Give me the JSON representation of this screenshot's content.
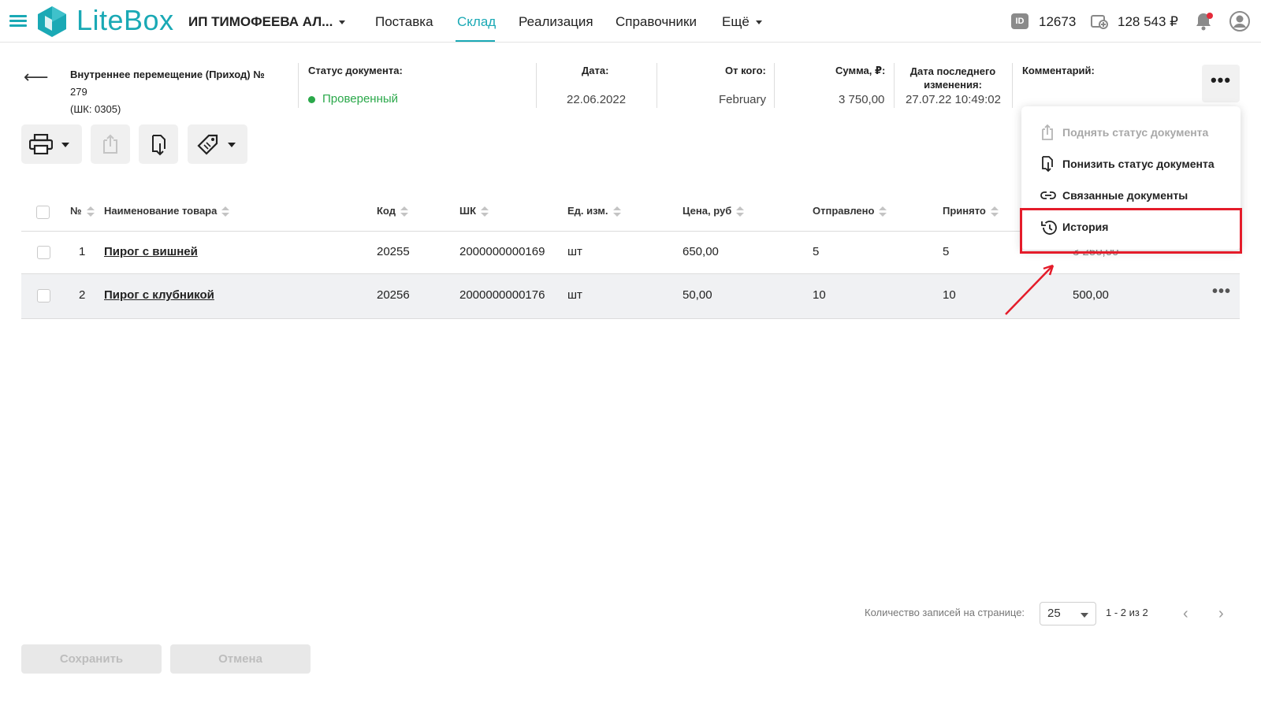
{
  "header": {
    "logo_text": "LiteBox",
    "org_name": "ИП ТИМОФЕЕВА АЛ...",
    "nav": [
      {
        "label": "Поставка"
      },
      {
        "label": "Склад"
      },
      {
        "label": "Реализация"
      },
      {
        "label": "Справочники"
      },
      {
        "label": "Ещё"
      }
    ],
    "id_badge": "ID",
    "id_value": "12673",
    "balance": "128 543 ₽"
  },
  "document": {
    "title": "Внутреннее перемещение (Приход) №",
    "number": "279",
    "barcode": "(ШК: 0305)",
    "status_label": "Статус документа:",
    "status_value": "Проверенный",
    "date_label": "Дата:",
    "date_value": "22.06.2022",
    "from_label": "От кого:",
    "from_value": "February",
    "sum_label": "Сумма, ₽:",
    "sum_value": "3 750,00",
    "modified_label": "Дата последнего изменения:",
    "modified_value": "27.07.22 10:49:02",
    "comment_label": "Комментарий:"
  },
  "table": {
    "columns": [
      "№",
      "Наименование товара",
      "Код",
      "ШК",
      "Ед. изм.",
      "Цена, руб",
      "Отправлено",
      "Принято"
    ],
    "rows": [
      {
        "n": "1",
        "name": "Пирог с вишней",
        "code": "20255",
        "barcode": "2000000000169",
        "unit": "шт",
        "price": "650,00",
        "sent": "5",
        "received": "5",
        "sum": "3 250,00"
      },
      {
        "n": "2",
        "name": "Пирог с клубникой",
        "code": "20256",
        "barcode": "2000000000176",
        "unit": "шт",
        "price": "50,00",
        "sent": "10",
        "received": "10",
        "sum": "500,00"
      }
    ]
  },
  "menu": {
    "items": [
      {
        "label": "Поднять статус документа",
        "icon": "raise-status-icon",
        "disabled": true
      },
      {
        "label": "Понизить статус документа",
        "icon": "lower-status-icon",
        "disabled": false
      },
      {
        "label": "Связанные документы",
        "icon": "link-icon",
        "disabled": false
      },
      {
        "label": "История",
        "icon": "history-icon",
        "disabled": false
      }
    ]
  },
  "pagination": {
    "label": "Количество записей на странице:",
    "page_size": "25",
    "range": "1 - 2 из 2"
  },
  "footer": {
    "save_label": "Сохранить",
    "cancel_label": "Отмена"
  },
  "colors": {
    "accent": "#1aa9b5",
    "status_green": "#2aa84a",
    "highlight_red": "#e41c2a"
  }
}
